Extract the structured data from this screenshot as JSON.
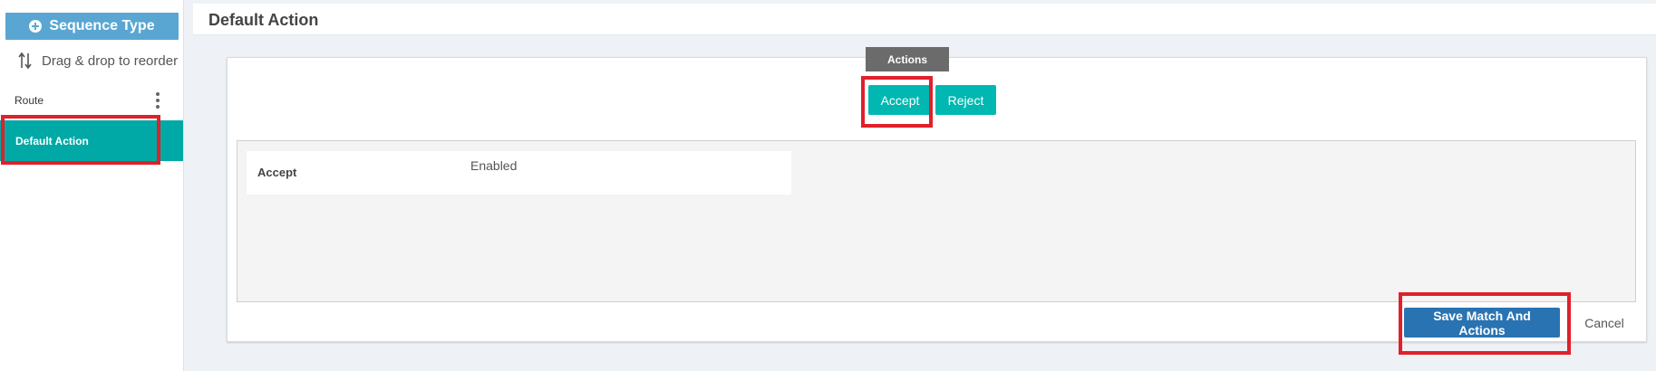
{
  "sidebar": {
    "sequence_type_label": "Sequence Type",
    "drag_hint": "Drag & drop to reorder",
    "items": [
      {
        "label": "Route",
        "selected": false
      },
      {
        "label": "Default Action",
        "selected": true
      }
    ]
  },
  "header": {
    "title": "Default Action"
  },
  "card": {
    "tab_label": "Actions",
    "buttons": {
      "accept": "Accept",
      "reject": "Reject"
    },
    "rows": [
      {
        "label": "Accept",
        "value": "Enabled"
      }
    ],
    "save_label": "Save Match And Actions",
    "cancel_label": "Cancel"
  },
  "colors": {
    "teal": "#00b8b1",
    "selected_item": "#00a9a5",
    "sequence_button": "#5aa6d2",
    "save_button": "#2a73b3",
    "highlight": "#e0202a"
  },
  "icons": {
    "sequence_type": "plus-circle-icon",
    "drag": "reorder-arrows-icon",
    "item_menu": "kebab-menu-icon"
  }
}
